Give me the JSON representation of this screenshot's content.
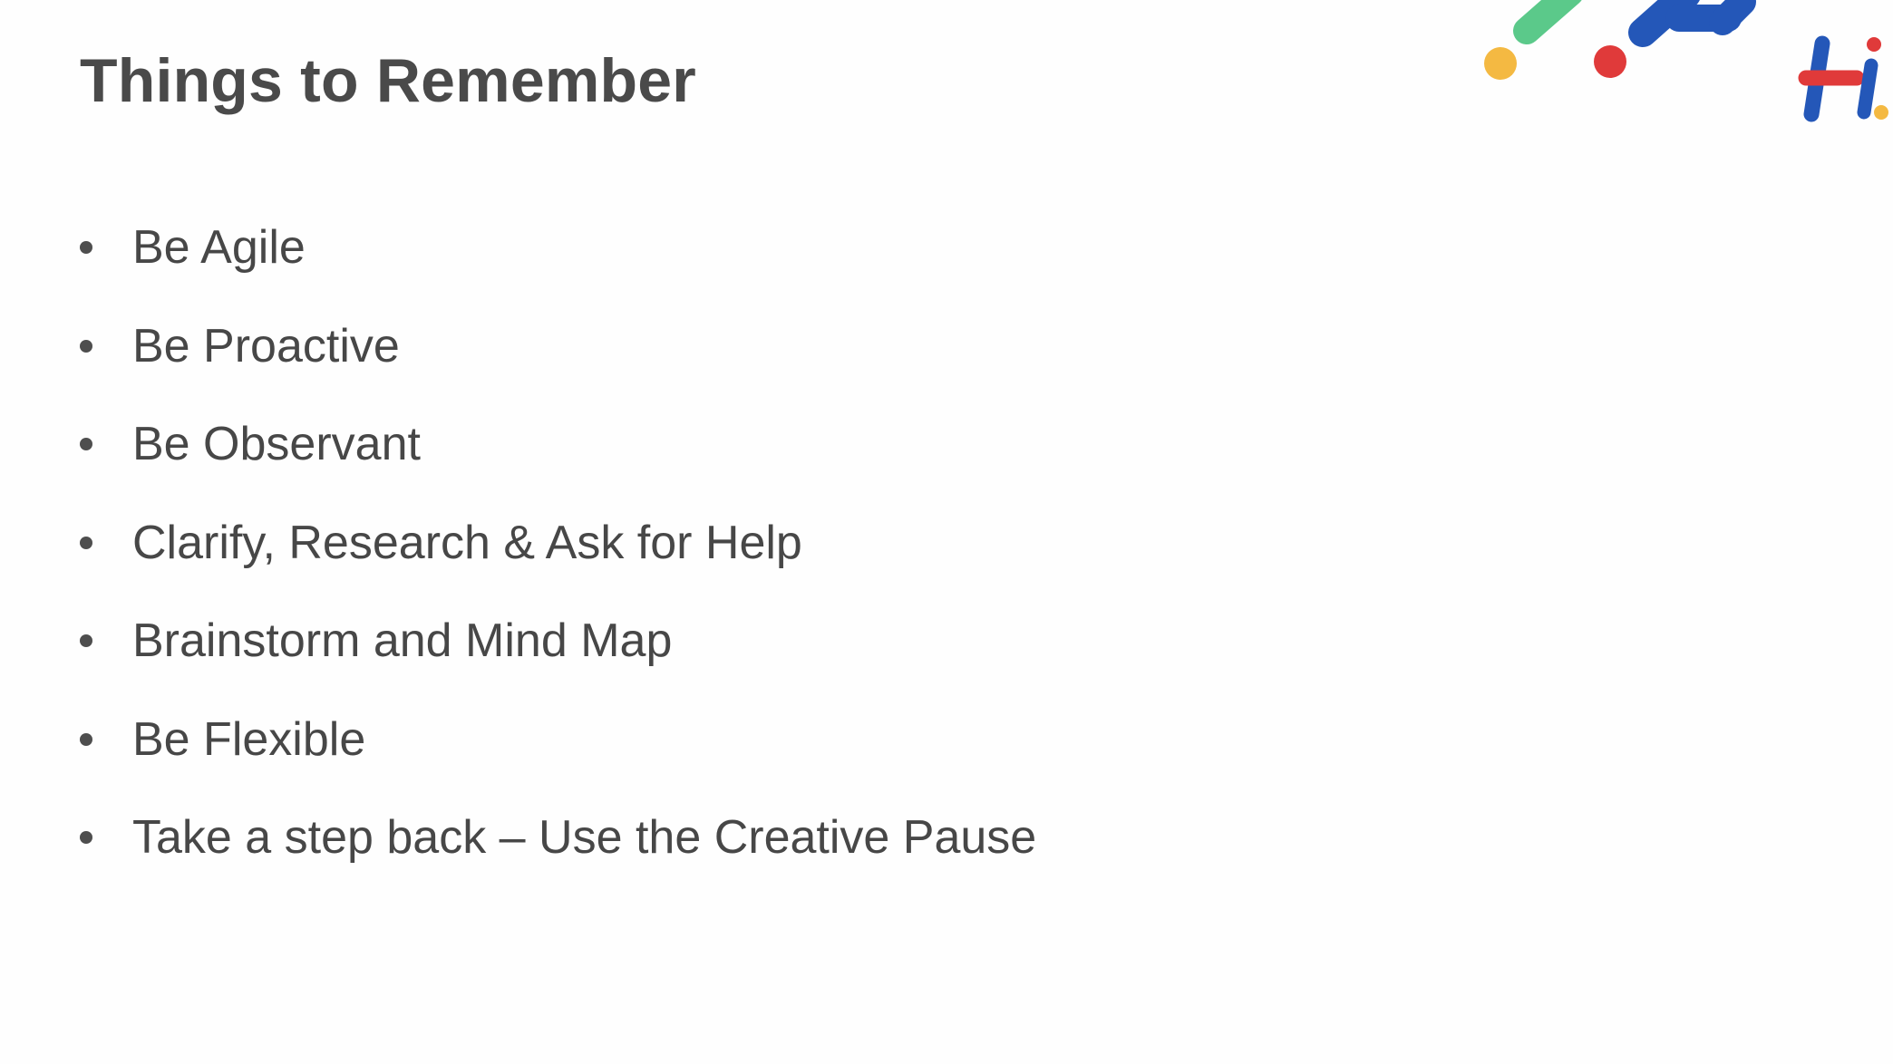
{
  "slide": {
    "title": "Things to Remember",
    "bullets": [
      {
        "text": "Be Agile"
      },
      {
        "text": "Be Proactive"
      },
      {
        "text": "Be Observant"
      },
      {
        "text": "Clarify, Research & Ask for Help"
      },
      {
        "text": "Brainstorm and Mind Map"
      },
      {
        "text": "Be Flexible"
      },
      {
        "text": "Take a step back – Use the Creative Pause"
      }
    ]
  },
  "branding": {
    "logo_icon": "hi-logo-icon",
    "colors": {
      "green": "#5bc98a",
      "blue": "#2457b8",
      "yellow": "#f4b942",
      "red": "#e03a3a"
    }
  }
}
